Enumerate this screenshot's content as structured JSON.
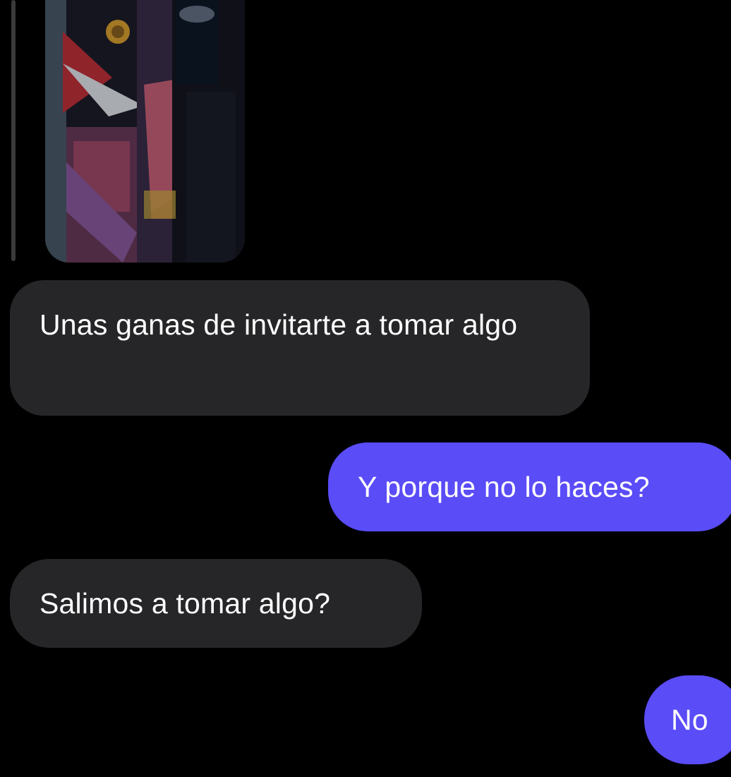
{
  "story": {
    "icon": "story-image-thumbnail"
  },
  "messages": [
    {
      "side": "received",
      "text": "Unas ganas de invitarte a tomar algo"
    },
    {
      "side": "sent",
      "text": "Y porque no lo haces?"
    },
    {
      "side": "received",
      "text": "Salimos a tomar algo?"
    },
    {
      "side": "sent",
      "text": "No"
    }
  ],
  "colors": {
    "background": "#000000",
    "received_bubble": "#262628",
    "sent_bubble": "#5a4cf7",
    "text": "#ffffff"
  }
}
